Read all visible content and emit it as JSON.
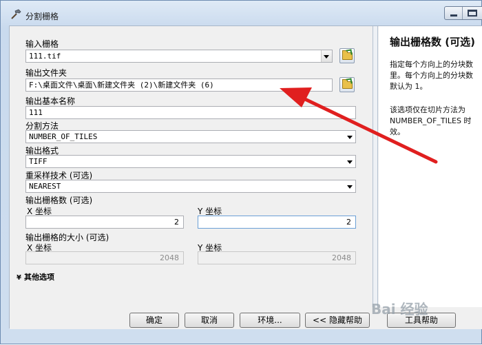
{
  "window": {
    "title": "分割栅格"
  },
  "form": {
    "input_raster": {
      "label": "输入栅格",
      "value": "111.tif"
    },
    "output_folder": {
      "label": "输出文件夹",
      "value": "F:\\桌面文件\\桌面\\新建文件夹 (2)\\新建文件夹 (6)"
    },
    "base_name": {
      "label": "输出基本名称",
      "value": "111"
    },
    "split_method": {
      "label": "分割方法",
      "value": "NUMBER_OF_TILES"
    },
    "output_format": {
      "label": "输出格式",
      "value": "TIFF"
    },
    "resampling": {
      "label": "重采样技术 (可选)",
      "value": "NEAREST"
    },
    "num_rasters": {
      "label": "输出栅格数 (可选)",
      "x_label": "X 坐标",
      "x_value": "2",
      "y_label": "Y 坐标",
      "y_value": "2"
    },
    "tile_size": {
      "label": "输出栅格的大小 (可选)",
      "x_label": "X 坐标",
      "x_value": "2048",
      "y_label": "Y 坐标",
      "y_value": "2048"
    },
    "other_options": "其他选项"
  },
  "help": {
    "title": "输出栅格数 (可选)",
    "para1": "指定每个方向上的分块数\n里。每个方向上的分块数\n默认为 1。",
    "para2": "该选项仅在切片方法为\nNUMBER_OF_TILES 时\n效。"
  },
  "buttons": {
    "ok": "确定",
    "cancel": "取消",
    "env": "环境...",
    "hide_help": "<< 隐藏帮助",
    "tool_help": "工具帮助"
  },
  "watermark": "Bai 经验",
  "colors": {
    "annotation_arrow": "#e01f1f"
  }
}
